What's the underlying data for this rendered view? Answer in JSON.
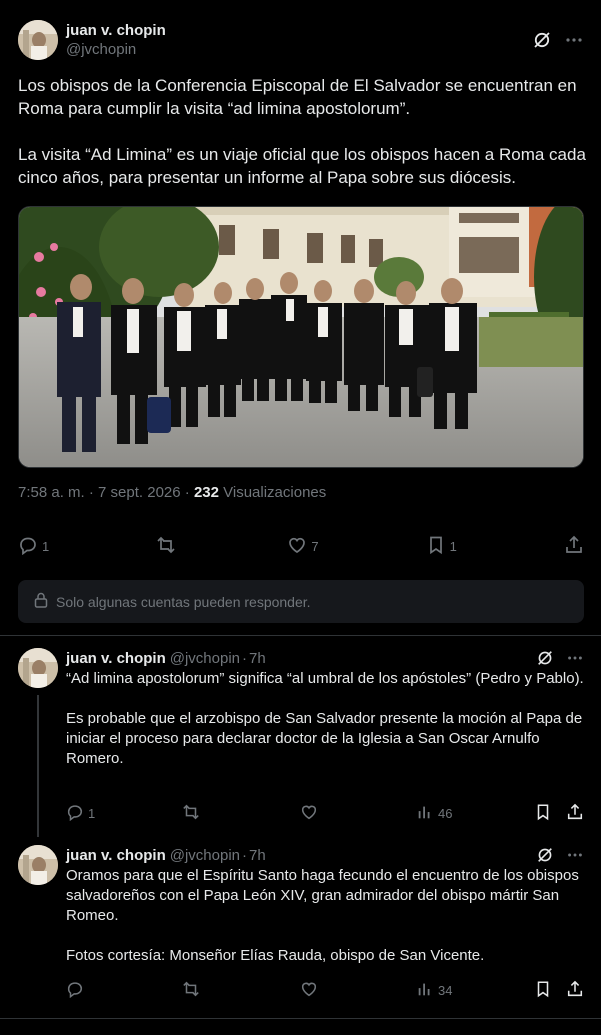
{
  "main_tweet": {
    "author_name": "juan v. chopin",
    "author_handle": "@jvchopin",
    "paragraphs": [
      "Los obispos de la Conferencia Episcopal de El Salvador se encuentran en Roma para cumplir la visita “ad limina apostolorum”.",
      "La visita “Ad Limina” es un viaje oficial que los obispos hacen a Roma cada cinco años, para presentar un informe al Papa sobre sus diócesis."
    ],
    "timestamp": "7:58 a. m. · 7 sept. 2026 · ",
    "views_count": "232",
    "views_label": " Visualizaciones",
    "actions": {
      "replies": "1",
      "reposts": "",
      "likes": "7",
      "bookmarks": "1"
    },
    "reply_restriction": "Solo algunas cuentas pueden responder."
  },
  "replies": [
    {
      "author_name": "juan v. chopin",
      "author_handle": "@jvchopin",
      "separator": "·",
      "time": "7h",
      "paragraphs": [
        "“Ad limina apostolorum” significa “al umbral de los apóstoles” (Pedro y Pablo).",
        "Es probable que el arzobispo de San Salvador presente la moción al Papa de iniciar el proceso para declarar doctor de la Iglesia a San Oscar Arnulfo Romero."
      ],
      "replies": "1",
      "views": "46"
    },
    {
      "author_name": "juan v. chopin",
      "author_handle": "@jvchopin",
      "separator": "·",
      "time": "7h",
      "paragraphs": [
        "Oramos para que el Espíritu Santo haga fecundo el encuentro de los obispos salvadoreños con el Papa León XIV, gran admirador del obispo mártir San Romeo.",
        "Fotos cortesía: Monseñor Elías Rauda, obispo de San Vicente."
      ],
      "replies": "",
      "views": "34"
    }
  ],
  "icons": {
    "grok": "grok-icon",
    "more": "more-dots-icon",
    "reply": "reply-bubble-icon",
    "repost": "repost-icon",
    "like": "heart-icon",
    "bookmark": "bookmark-icon",
    "share": "share-icon",
    "views": "views-bar-icon",
    "lock": "lock-icon"
  },
  "colors": {
    "background": "#000000",
    "text": "#e7e9ea",
    "muted": "#71767b",
    "panel": "#16181c",
    "border": "#2f3336"
  }
}
